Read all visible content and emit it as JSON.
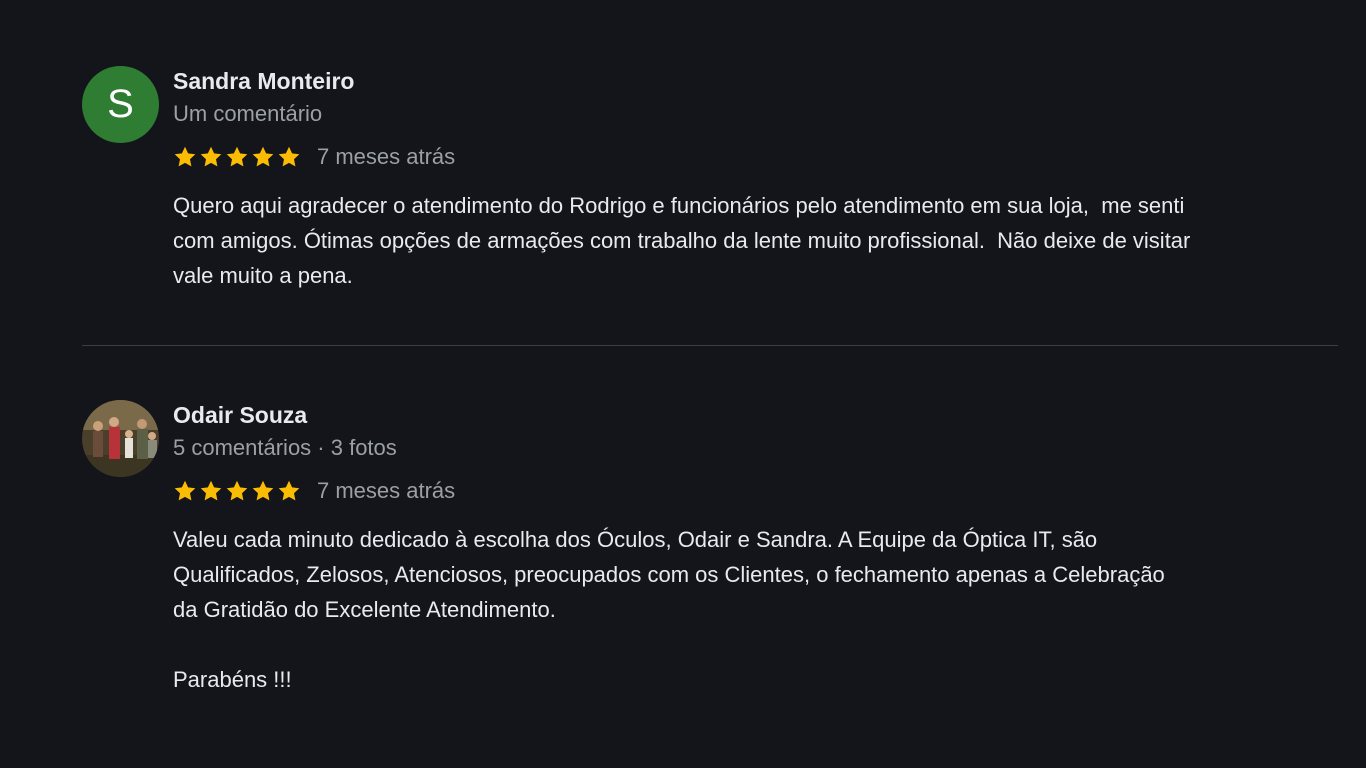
{
  "reviews": [
    {
      "avatar_letter": "S",
      "author": "Sandra Monteiro",
      "meta": "Um comentário",
      "rating": 5,
      "time": "7 meses atrás",
      "text": "Quero aqui agradecer o atendimento do Rodrigo e funcionários pelo atendimento em sua loja,  me senti\ncom amigos. Ótimas opções de armações com trabalho da lente muito profissional.  Não deixe de visitar\nvale muito a pena."
    },
    {
      "author": "Odair Souza",
      "meta": "5 comentários · 3 fotos",
      "rating": 5,
      "time": "7 meses atrás",
      "text": "Valeu cada minuto dedicado à escolha dos Óculos, Odair e Sandra. A Equipe da Óptica IT, são\nQualificados, Zelosos, Atenciosos, preocupados com os Clientes, o fechamento apenas a Celebração\nda Gratidão do Excelente Atendimento.\n\nParabéns !!!"
    }
  ],
  "colors": {
    "background": "#14151b",
    "star": "#fbbc04",
    "avatar_green": "#2e7d32",
    "secondary_text": "#9aa0a6"
  },
  "icons": {
    "star": "star-icon"
  }
}
